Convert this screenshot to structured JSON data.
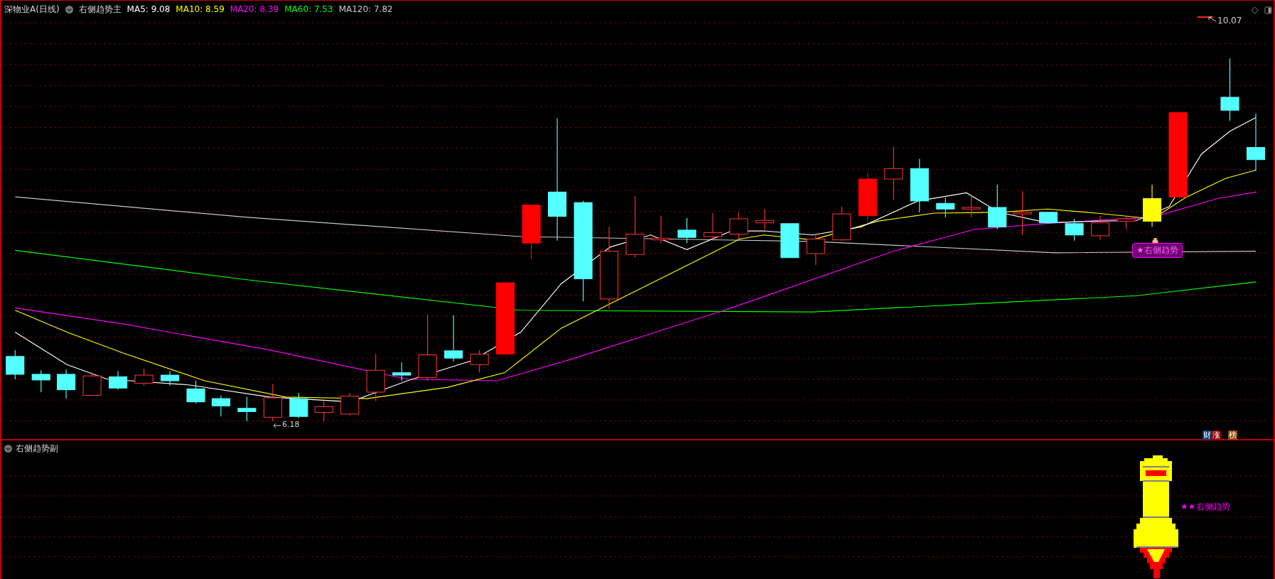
{
  "header": {
    "stock": "深物业A(日线)",
    "indicator": "右侧趋势主",
    "ma": [
      {
        "label": "MA5: 9.08",
        "color": "#ffffff"
      },
      {
        "label": "MA10: 8.59",
        "color": "#ffff00"
      },
      {
        "label": "MA20: 8.39",
        "color": "#ff00ff"
      },
      {
        "label": "MA60: 7.53",
        "color": "#00ff00"
      },
      {
        "label": "MA120: 7.82",
        "color": "#c8c8c8"
      }
    ]
  },
  "main_chart": {
    "high_label": "10.07",
    "low_label": "6.18",
    "signal_badge": "★右侧趋势",
    "tags": [
      {
        "text": "财",
        "color": "#0a3a6e"
      },
      {
        "text": "涨",
        "color": "#8b0000"
      },
      {
        "text": "榜",
        "color": "#8b4a00"
      }
    ]
  },
  "sub_panel": {
    "title": "右侧趋势副",
    "signal_label": "★★右侧趋势"
  }
}
